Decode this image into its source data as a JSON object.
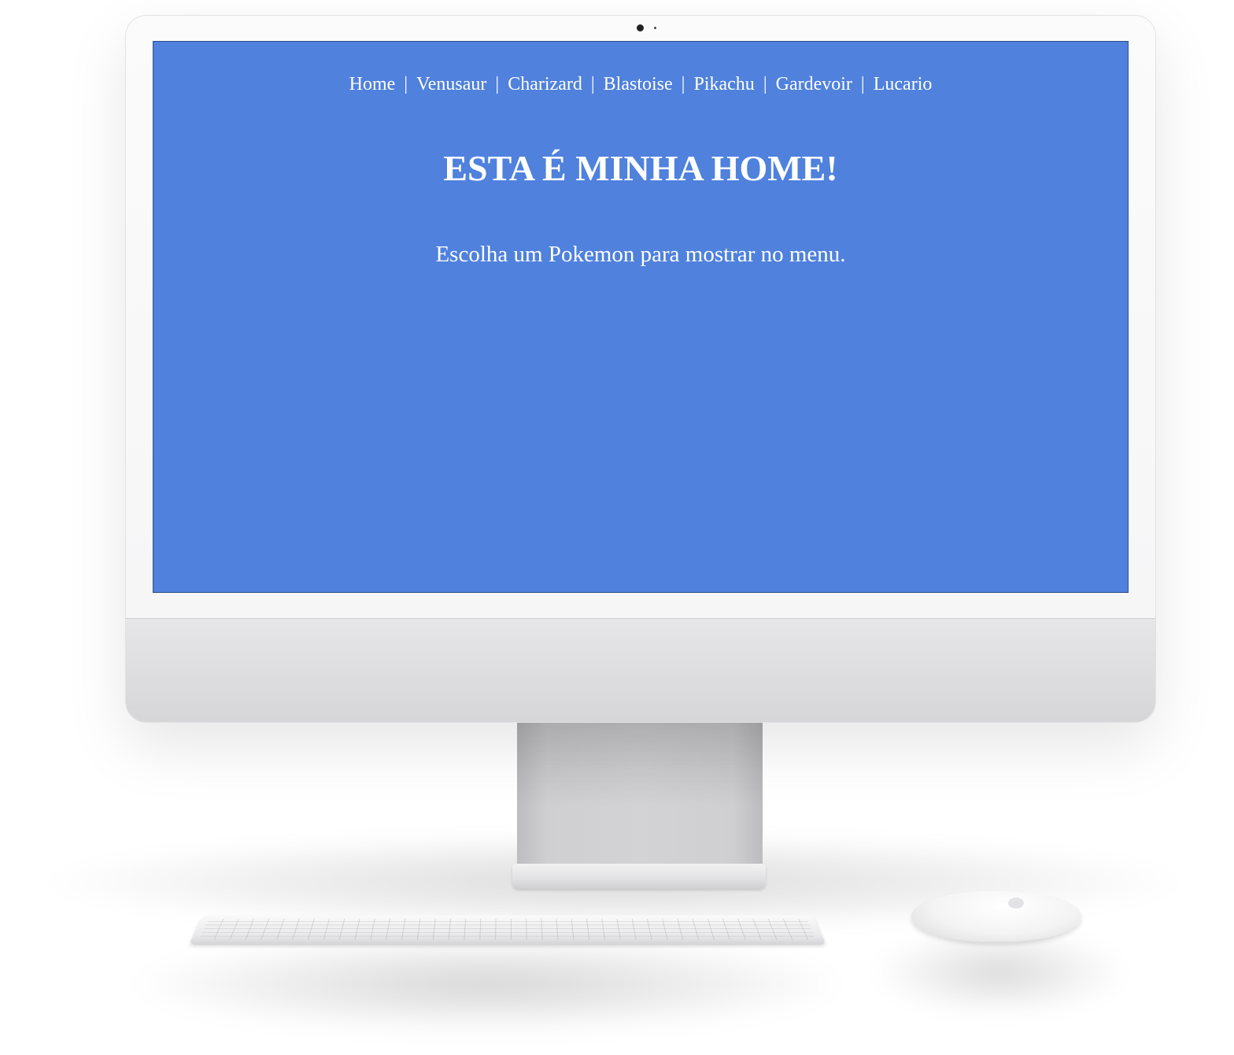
{
  "nav": {
    "items": [
      {
        "label": "Home"
      },
      {
        "label": "Venusaur"
      },
      {
        "label": "Charizard"
      },
      {
        "label": "Blastoise"
      },
      {
        "label": "Pikachu"
      },
      {
        "label": "Gardevoir"
      },
      {
        "label": "Lucario"
      }
    ],
    "separator": "|"
  },
  "main": {
    "title": "ESTA É MINHA HOME!",
    "text": "Escolha um Pokemon para mostrar no menu."
  },
  "colors": {
    "page_background": "#4f81dd",
    "text": "#ffffff"
  },
  "icons": {
    "camera": "webcam-icon",
    "mouse_logo": "apple-logo-icon"
  }
}
